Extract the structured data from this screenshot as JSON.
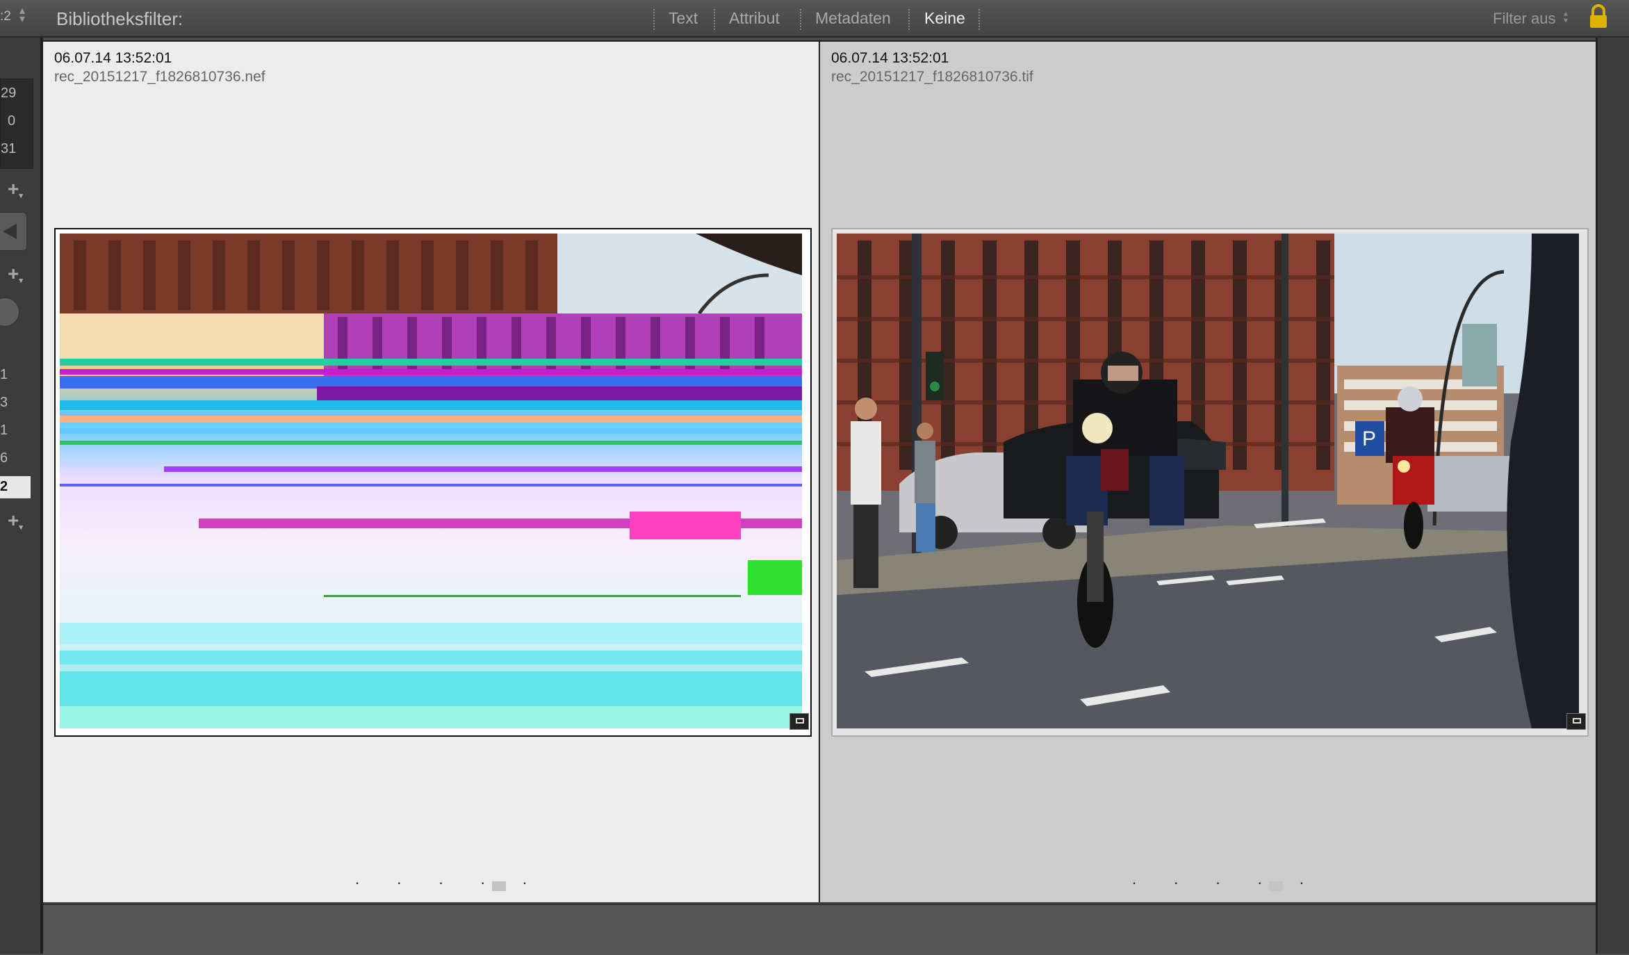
{
  "filter_bar": {
    "left_counter": ":2",
    "title": "Bibliotheksfilter:",
    "tabs": [
      {
        "label": "Text",
        "active": false
      },
      {
        "label": "Attribut",
        "active": false
      },
      {
        "label": "Metadaten",
        "active": false
      },
      {
        "label": "Keine",
        "active": true
      }
    ],
    "preset_label": "Filter aus",
    "lock_icon": "lock-icon"
  },
  "left_panel": {
    "counts": [
      "29",
      "0",
      "31"
    ],
    "list_numbers": [
      "1",
      "3",
      "1",
      "6",
      "2"
    ],
    "selected_number": "2",
    "add_icon": "plus-icon"
  },
  "compare": {
    "left": {
      "date": "06.07.14 13:52:01",
      "filename": "rec_20151217_f1826810736.nef",
      "rating_dots": ". . . . .",
      "photo": "corrupted glitch image of city street"
    },
    "right": {
      "date": "06.07.14 13:52:01",
      "filename": "rec_20151217_f1826810736.tif",
      "rating_dots": ". . . . .",
      "photo": "motorcyclists riding down city street in front of brick building"
    }
  }
}
